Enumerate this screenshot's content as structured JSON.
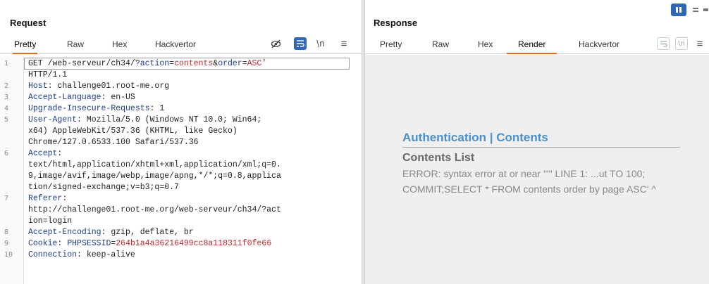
{
  "request": {
    "title": "Request",
    "tabs": [
      "Pretty",
      "Raw",
      "Hex",
      "Hackvertor"
    ],
    "active_tab": "Pretty",
    "lines": [
      {
        "n": "1",
        "parts": [
          [
            "plain",
            "GET /web-serveur/ch34/?"
          ],
          [
            "k",
            "action"
          ],
          [
            "plain",
            "="
          ],
          [
            "red",
            "contents"
          ],
          [
            "plain",
            "&"
          ],
          [
            "k",
            "order"
          ],
          [
            "plain",
            "="
          ],
          [
            "red",
            "ASC'"
          ]
        ]
      },
      {
        "n": "",
        "parts": [
          [
            "plain",
            "HTTP/1.1"
          ]
        ]
      },
      {
        "n": "2",
        "parts": [
          [
            "k",
            "Host"
          ],
          [
            "plain",
            ": challenge01.root-me.org"
          ]
        ]
      },
      {
        "n": "3",
        "parts": [
          [
            "k",
            "Accept-Language"
          ],
          [
            "plain",
            ": en-US"
          ]
        ]
      },
      {
        "n": "4",
        "parts": [
          [
            "k",
            "Upgrade-Insecure-Requests"
          ],
          [
            "plain",
            ": 1"
          ]
        ]
      },
      {
        "n": "5",
        "parts": [
          [
            "k",
            "User-Agent"
          ],
          [
            "plain",
            ": Mozilla/5.0 (Windows NT 10.0; Win64;"
          ]
        ]
      },
      {
        "n": "",
        "parts": [
          [
            "plain",
            "x64) AppleWebKit/537.36 (KHTML, like Gecko)"
          ]
        ]
      },
      {
        "n": "",
        "parts": [
          [
            "plain",
            "Chrome/127.0.6533.100 Safari/537.36"
          ]
        ]
      },
      {
        "n": "6",
        "parts": [
          [
            "k",
            "Accept"
          ],
          [
            "plain",
            ":"
          ]
        ]
      },
      {
        "n": "",
        "parts": [
          [
            "plain",
            "text/html,application/xhtml+xml,application/xml;q=0."
          ]
        ]
      },
      {
        "n": "",
        "parts": [
          [
            "plain",
            "9,image/avif,image/webp,image/apng,*/*;q=0.8,applica"
          ]
        ]
      },
      {
        "n": "",
        "parts": [
          [
            "plain",
            "tion/signed-exchange;v=b3;q=0.7"
          ]
        ]
      },
      {
        "n": "7",
        "parts": [
          [
            "k",
            "Referer"
          ],
          [
            "plain",
            ":"
          ]
        ]
      },
      {
        "n": "",
        "parts": [
          [
            "plain",
            "http://challenge01.root-me.org/web-serveur/ch34/?act"
          ]
        ]
      },
      {
        "n": "",
        "parts": [
          [
            "plain",
            "ion=login"
          ]
        ]
      },
      {
        "n": "8",
        "parts": [
          [
            "k",
            "Accept-Encoding"
          ],
          [
            "plain",
            ": gzip, deflate, br"
          ]
        ]
      },
      {
        "n": "9",
        "parts": [
          [
            "k",
            "Cookie"
          ],
          [
            "plain",
            ": "
          ],
          [
            "k",
            "PHPSESSID"
          ],
          [
            "plain",
            "="
          ],
          [
            "red",
            "264b1a4a36216499cc8a118311f0fe66"
          ]
        ]
      },
      {
        "n": "10",
        "parts": [
          [
            "k",
            "Connection"
          ],
          [
            "plain",
            ": keep-alive"
          ]
        ]
      }
    ],
    "icons": {
      "eye_slash": "eye-slash-icon",
      "wrap": "wrap-icon",
      "newline": "\\n",
      "menu": "≡"
    }
  },
  "response": {
    "title": "Response",
    "tabs": [
      "Pretty",
      "Raw",
      "Hex",
      "Render",
      "Hackvertor"
    ],
    "active_tab": "Render",
    "render": {
      "auth_left": "Authentication",
      "auth_sep": " | ",
      "auth_right": "Contents",
      "contents_list": "Contents List",
      "error": "ERROR: syntax error at or near \"'\" LINE 1: ...ut TO 100; COMMIT;SELECT * FROM contents order by page ASC' ^"
    }
  },
  "colors": {
    "accent_orange": "#e8691f",
    "toolbar_blue": "#2f68b7",
    "header_key": "#1e3a8f",
    "value_red": "#c3272a",
    "render_link": "#4a90c9"
  }
}
